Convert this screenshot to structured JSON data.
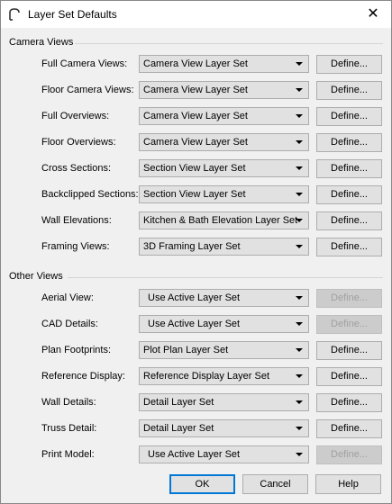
{
  "window": {
    "title": "Layer Set Defaults",
    "close_symbol": "✕",
    "icon": "app-logo-icon"
  },
  "camera_views": {
    "heading": "Camera Views",
    "rows": [
      {
        "label": "Full Camera Views:",
        "value": "Camera View Layer Set",
        "define": "Define...",
        "define_enabled": true
      },
      {
        "label": "Floor Camera Views:",
        "value": "Camera View Layer Set",
        "define": "Define...",
        "define_enabled": true
      },
      {
        "label": "Full Overviews:",
        "value": "Camera View Layer Set",
        "define": "Define...",
        "define_enabled": true
      },
      {
        "label": "Floor Overviews:",
        "value": "Camera View Layer Set",
        "define": "Define...",
        "define_enabled": true
      },
      {
        "label": "Cross Sections:",
        "value": "Section View Layer Set",
        "define": "Define...",
        "define_enabled": true
      },
      {
        "label": "Backclipped Sections:",
        "value": "Section View Layer Set",
        "define": "Define...",
        "define_enabled": true
      },
      {
        "label": "Wall Elevations:",
        "value": "Kitchen & Bath Elevation Layer Set",
        "define": "Define...",
        "define_enabled": true
      },
      {
        "label": "Framing Views:",
        "value": "3D Framing Layer Set",
        "define": "Define...",
        "define_enabled": true
      }
    ]
  },
  "other_views": {
    "heading": "Other Views",
    "rows": [
      {
        "label": "Aerial View:",
        "value": "Use Active Layer Set",
        "define": "Define...",
        "define_enabled": false
      },
      {
        "label": "CAD Details:",
        "value": "Use Active Layer Set",
        "define": "Define...",
        "define_enabled": false
      },
      {
        "label": "Plan Footprints:",
        "value": "Plot Plan Layer Set",
        "define": "Define...",
        "define_enabled": true
      },
      {
        "label": "Reference Display:",
        "value": "Reference Display Layer Set",
        "define": "Define...",
        "define_enabled": true
      },
      {
        "label": "Wall Details:",
        "value": "Detail Layer Set",
        "define": "Define...",
        "define_enabled": true
      },
      {
        "label": "Truss Detail:",
        "value": "Detail Layer Set",
        "define": "Define...",
        "define_enabled": true
      },
      {
        "label": "Print Model:",
        "value": "Use Active Layer Set",
        "define": "Define...",
        "define_enabled": false
      }
    ]
  },
  "buttons": {
    "ok": "OK",
    "cancel": "Cancel",
    "help": "Help"
  }
}
